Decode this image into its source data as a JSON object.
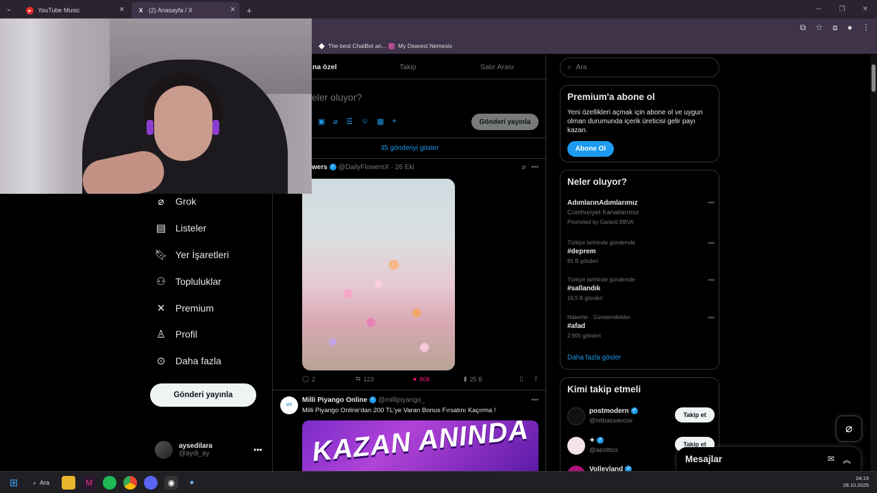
{
  "browser": {
    "tabs": [
      {
        "title": "YouTube Music",
        "active": false
      },
      {
        "title": "(2) Anasayfa / X",
        "active": true
      }
    ],
    "new_tab": "+",
    "bookmarks": [
      {
        "label": "The best ChatBot an..."
      },
      {
        "label": "My Dearest Nemesis"
      }
    ]
  },
  "nav": {
    "items": [
      {
        "label": "Grok",
        "icon": "grok-icon"
      },
      {
        "label": "Listeler",
        "icon": "list-icon"
      },
      {
        "label": "Yer İşaretleri",
        "icon": "bookmark-icon"
      },
      {
        "label": "Topluluklar",
        "icon": "communities-icon"
      },
      {
        "label": "Premium",
        "icon": "x-logo-icon"
      },
      {
        "label": "Profil",
        "icon": "profile-icon"
      },
      {
        "label": "Daha fazla",
        "icon": "more-circle-icon"
      }
    ],
    "post_button": "Gönderi yayınla",
    "account": {
      "name": "aysedilara",
      "handle": "@aydi_ay"
    }
  },
  "timeline": {
    "tabs": [
      "na özel",
      "Takip",
      "Satır Arası"
    ],
    "compose_placeholder": "eler oluyor?",
    "compose_button": "Gönderi yayınla",
    "show_more": "35 gönderiyi göster",
    "tweet1": {
      "name": "wers",
      "handle": "@DailyFlowersX",
      "date": "· 26 Eki",
      "replies": "2",
      "reposts": "123",
      "likes": "808",
      "views": "25 B"
    },
    "tweet2": {
      "name": "Milli Piyango Online",
      "handle": "@millipiyango_",
      "text": "Milli Piyango Online'dan 200 TL'ye Varan Bonus Fırsatını Kaçırma !",
      "promo_text": "KAZAN ANINDA"
    }
  },
  "sidebar": {
    "search_placeholder": "Ara",
    "premium": {
      "title": "Premium'a abone ol",
      "text": "Yeni özellikleri açmak için abone ol ve uygun olman durumunda içerik üreticisi gelir payı kazan.",
      "button": "Abone Ol"
    },
    "trends": {
      "title": "Neler oluyor?",
      "items": [
        {
          "ctx": "",
          "topic": "AdımlarınAdımlarımız",
          "sub": "Cumhuriyet Kanatlarımız",
          "count": "Promoted by Garanti BBVA"
        },
        {
          "ctx": "Türkiye tarihinde gündemde",
          "topic": "#deprem",
          "sub": "",
          "count": "85 B gönderi"
        },
        {
          "ctx": "Türkiye tarihinde gündemde",
          "topic": "#sallandık",
          "sub": "",
          "count": "16,5 B gönderi"
        },
        {
          "ctx": "Haberler · Gündemdekiler",
          "topic": "#afad",
          "sub": "",
          "count": "2.900 gönderi"
        }
      ],
      "more": "Daha fazla göster"
    },
    "who_to_follow": {
      "title": "Kimi takip etmeli",
      "items": [
        {
          "name": "postmodern",
          "handle": "@istbassavcisi",
          "button": "Takip et"
        },
        {
          "name": "✦",
          "handle": "@aesttics",
          "button": "Takip et"
        },
        {
          "name": "Volleyland",
          "handle": "",
          "button": ""
        }
      ]
    }
  },
  "messages": {
    "title": "Mesajlar"
  },
  "taskbar": {
    "search_label": "Ara",
    "time": "04:19",
    "date": "28.10.2025"
  }
}
